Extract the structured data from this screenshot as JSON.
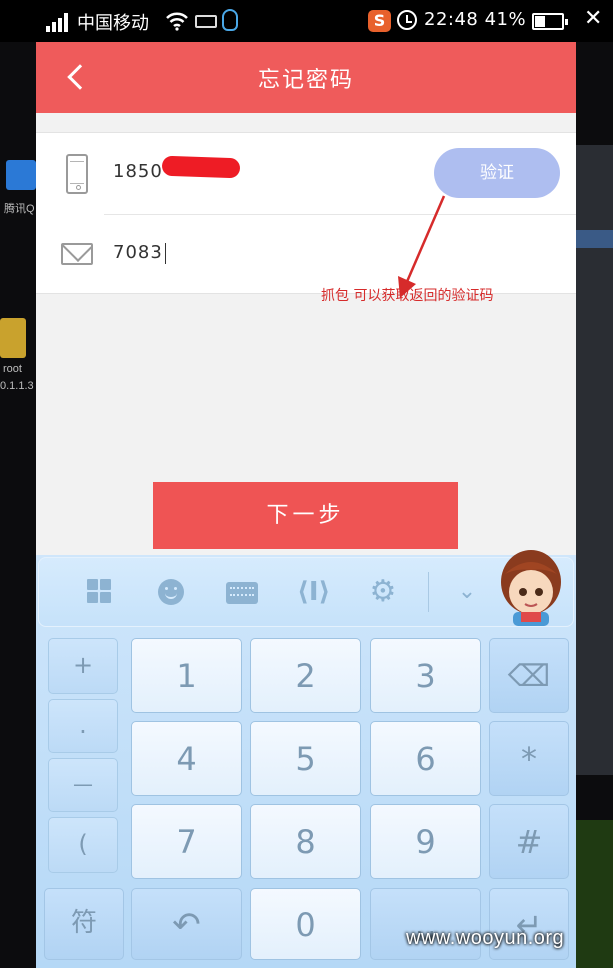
{
  "status_bar": {
    "carrier": "中国移动",
    "time": "22:48",
    "battery": "41%",
    "close": "✕"
  },
  "desktop": {
    "icon1_label": "腾讯Q",
    "icon2_label": "root",
    "icon2_sub": "0.1.1.3"
  },
  "header": {
    "title": "忘记密码"
  },
  "form": {
    "phone_value": "1850",
    "code_value": "7083",
    "verify_label": "验证"
  },
  "annotation": {
    "text": "抓包 可以获取返回的验证码",
    "color": "#d62b2b"
  },
  "next_label": "下一步",
  "keyboard": {
    "toolbar_icons": [
      "grid-icon",
      "smile-icon",
      "keyboard-icon",
      "cursor-move-icon",
      "gear-icon",
      "collapse-icon"
    ],
    "left_column": [
      "+",
      ".",
      "—",
      "("
    ],
    "digits": [
      "1",
      "2",
      "3",
      "4",
      "5",
      "6",
      "7",
      "8",
      "9",
      "0"
    ],
    "right_column": [
      "⌫",
      "*",
      "#"
    ],
    "symbol_key": "符",
    "undo_key": "↶",
    "space_key": "␣",
    "enter_key": "↵"
  },
  "colors": {
    "accent": "#ef5b5b",
    "verify": "#aebef0",
    "keyboard": "#c7e2f9"
  },
  "watermark": "www.wooyun.org"
}
